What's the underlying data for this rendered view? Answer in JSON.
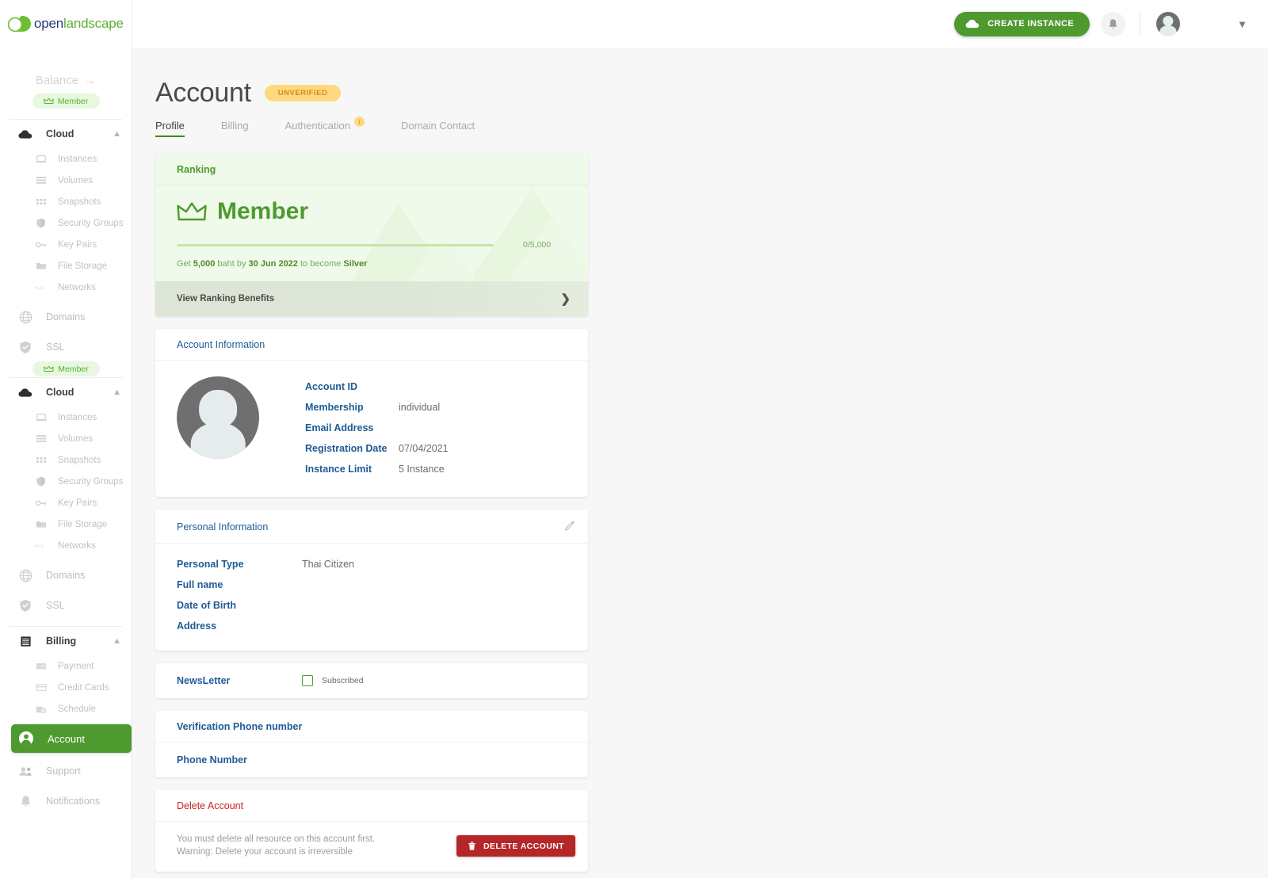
{
  "brand": {
    "logo_open": "open",
    "logo_landscape": "landscape",
    "accent_green": "#4e9a2f",
    "accent_navy": "#28377a",
    "danger_red": "#b52626"
  },
  "sidebar": {
    "balance_label": "Balance",
    "balance_arrow": "→",
    "rank_badge": "Member",
    "rank_badge_floating": "Member",
    "groups": [
      {
        "label": "Cloud",
        "icon": "cloud-icon",
        "items": [
          {
            "label": "Instances",
            "icon": "laptop-icon"
          },
          {
            "label": "Volumes",
            "icon": "stack-icon"
          },
          {
            "label": "Snapshots",
            "icon": "grid-icon"
          },
          {
            "label": "Security Groups",
            "icon": "shield-icon"
          },
          {
            "label": "Key Pairs",
            "icon": "key-icon"
          },
          {
            "label": "File Storage",
            "icon": "folder-icon"
          },
          {
            "label": "Networks",
            "icon": "code-icon"
          }
        ]
      }
    ],
    "top_items_a": [
      {
        "label": "Domains",
        "icon": "globe-icon"
      },
      {
        "label": "SSL",
        "icon": "shield-check-icon"
      }
    ],
    "groups_b": [
      {
        "label": "Cloud",
        "icon": "cloud-icon",
        "items": [
          {
            "label": "Instances",
            "icon": "laptop-icon"
          },
          {
            "label": "Volumes",
            "icon": "stack-icon"
          },
          {
            "label": "Snapshots",
            "icon": "grid-icon"
          },
          {
            "label": "Security Groups",
            "icon": "shield-icon"
          },
          {
            "label": "Key Pairs",
            "icon": "key-icon"
          },
          {
            "label": "File Storage",
            "icon": "folder-icon"
          },
          {
            "label": "Networks",
            "icon": "code-icon"
          }
        ]
      }
    ],
    "top_items_b": [
      {
        "label": "Domains",
        "icon": "globe-icon"
      },
      {
        "label": "SSL",
        "icon": "shield-check-icon"
      }
    ],
    "billing": {
      "label": "Billing",
      "icon": "billing-icon",
      "items": [
        {
          "label": "Payment",
          "icon": "payment-icon"
        },
        {
          "label": "Credit Cards",
          "icon": "card-icon"
        },
        {
          "label": "Schedule",
          "icon": "schedule-icon"
        }
      ]
    },
    "bottom_items": [
      {
        "label": "Account",
        "icon": "person-circle-icon",
        "active": true
      },
      {
        "label": "Support",
        "icon": "people-icon",
        "active": false
      },
      {
        "label": "Notifications",
        "icon": "bell-icon",
        "active": false
      }
    ]
  },
  "topbar": {
    "create_instance_label": "CREATE INSTANCE",
    "create_instance_icon": "cloud-icon",
    "bell_icon": "bell-icon",
    "avatar": "user-avatar",
    "caret_icon": "chevron-down-icon"
  },
  "page": {
    "title": "Account",
    "status_badge": "UNVERIFIED",
    "tabs": [
      {
        "label": "Profile",
        "active": true,
        "info_badge": ""
      },
      {
        "label": "Billing",
        "active": false,
        "info_badge": ""
      },
      {
        "label": "Authentication",
        "active": false,
        "info_badge": "i"
      },
      {
        "label": "Domain Contact",
        "active": false,
        "info_badge": ""
      }
    ]
  },
  "ranking": {
    "header": "Ranking",
    "tier": "Member",
    "crown_icon": "crown-icon",
    "progress_current": 0,
    "progress_target": 5000,
    "progress_text": "0/5,000",
    "progress_percent": 0,
    "note_prefix": "Get",
    "note_amount": "5,000",
    "note_mid": "baht by",
    "note_date": "30 Jun 2022",
    "note_suffix": "to become",
    "note_tier": "Silver",
    "footer_label": "View Ranking Benefits",
    "footer_chevron": "❯"
  },
  "account_information": {
    "header": "Account Information",
    "avatar": "user-avatar-large",
    "rows": [
      {
        "key": "Account ID",
        "value": ""
      },
      {
        "key": "Membership",
        "value": "individual"
      },
      {
        "key": "Email Address",
        "value": ""
      },
      {
        "key": "Registration Date",
        "value": "07/04/2021"
      },
      {
        "key": "Instance Limit",
        "value": "5 Instance"
      }
    ]
  },
  "personal_information": {
    "header": "Personal Information",
    "edit_icon": "pencil-icon",
    "rows": [
      {
        "key": "Personal Type",
        "value": "Thai Citizen"
      },
      {
        "key": "Full name",
        "value": ""
      },
      {
        "key": "Date of Birth",
        "value": ""
      },
      {
        "key": "Address",
        "value": ""
      }
    ]
  },
  "newsletter": {
    "label": "NewsLetter",
    "checkbox_label": "Subscribed",
    "checked": false
  },
  "verification": {
    "header": "Verification Phone number",
    "phone_label": "Phone Number",
    "phone_value": ""
  },
  "delete_account": {
    "header": "Delete Account",
    "line1": "You must delete all resource on this account first.",
    "line2": "Warning: Delete your account is irreversible",
    "button_label": "DELETE ACCOUNT",
    "button_icon": "trash-icon"
  }
}
